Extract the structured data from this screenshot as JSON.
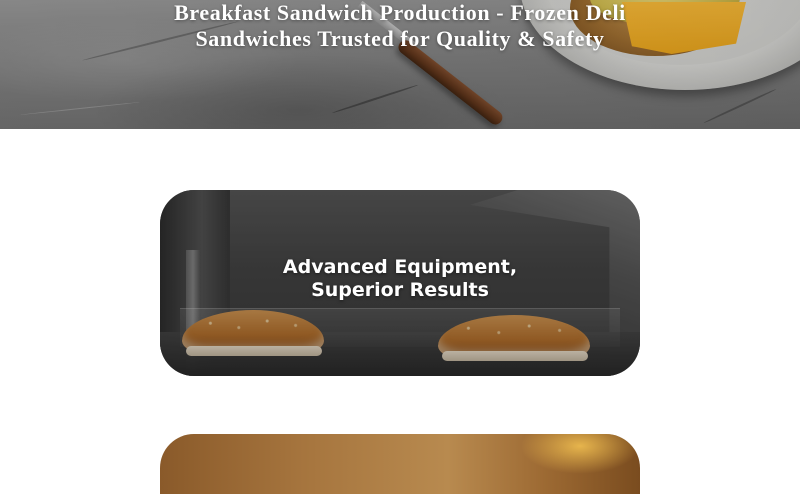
{
  "hero": {
    "title_line1": "Breakfast Sandwich Production - Frozen Deli",
    "title_line2": "Sandwiches Trusted for Quality & Safety"
  },
  "feature": {
    "title_line1": "Advanced Equipment,",
    "title_line2": "Superior Results"
  }
}
